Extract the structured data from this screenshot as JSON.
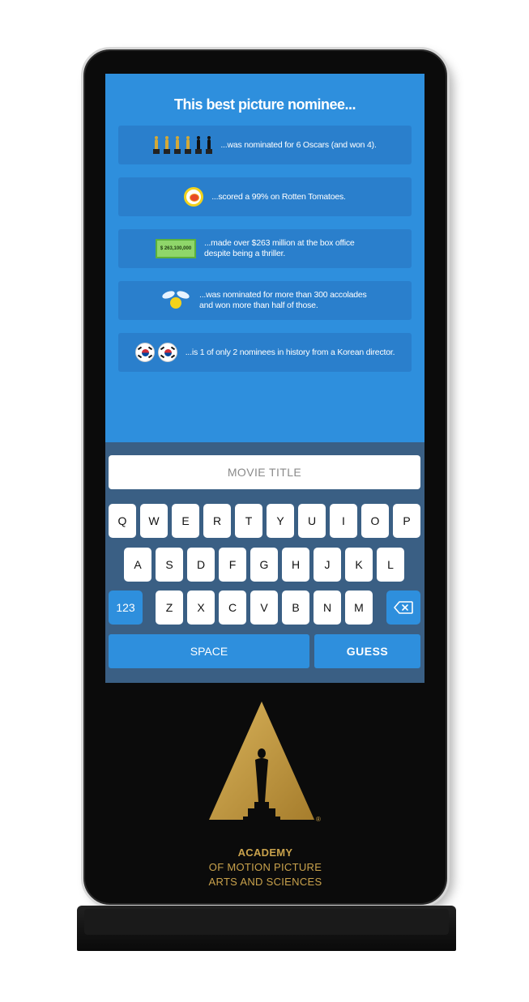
{
  "screen": {
    "title": "This best picture nominee...",
    "clues": [
      {
        "icon": "oscar-statuettes-icon",
        "text": "...was nominated for 6 Oscars (and won 4)."
      },
      {
        "icon": "rotten-tomatoes-icon",
        "text": "...scored a 99% on Rotten Tomatoes."
      },
      {
        "icon": "money-bill-icon",
        "icon_text": "$ 263,100,000",
        "text": "...made over $263 million at the box office despite being a thriller."
      },
      {
        "icon": "firefly-icon",
        "text": "...was nominated for more than 300 accolades and won more than half of those."
      },
      {
        "icon": "korea-flag-icon",
        "text": "...is 1 of only 2 nominees in history from a Korean director."
      }
    ],
    "oscars": {
      "nominated": 6,
      "won": 4
    }
  },
  "keyboard": {
    "input_placeholder": "MOVIE TITLE",
    "input_value": "",
    "row1": [
      "Q",
      "W",
      "E",
      "R",
      "T",
      "Y",
      "U",
      "I",
      "O",
      "P"
    ],
    "row2": [
      "A",
      "S",
      "D",
      "F",
      "G",
      "H",
      "J",
      "K",
      "L"
    ],
    "row3": [
      "Z",
      "X",
      "C",
      "V",
      "B",
      "N",
      "M"
    ],
    "numbers_label": "123",
    "space_label": "SPACE",
    "guess_label": "GUESS",
    "backspace_icon": "backspace-icon"
  },
  "branding": {
    "line1": "ACADEMY",
    "line2": "OF MOTION PICTURE",
    "line3": "ARTS AND SCIENCES",
    "registered": "®"
  },
  "colors": {
    "screen_bg": "#2e8fdd",
    "card_bg": "#2a7fcc",
    "keyboard_bg": "#3a5f84",
    "gold": "#c9a24c"
  }
}
